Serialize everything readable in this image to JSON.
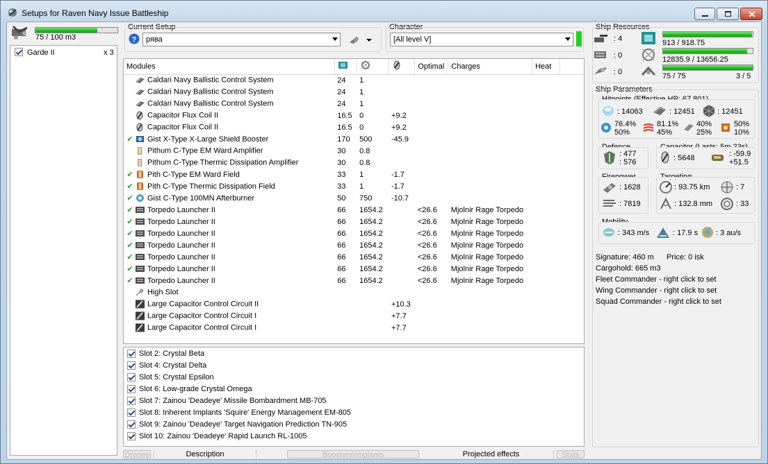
{
  "window": {
    "title": "Setups for Raven Navy Issue Battleship"
  },
  "drones": {
    "capacity_text": "75 / 100 m3",
    "capacity_fraction": 0.75,
    "items": [
      {
        "name": "Garde II",
        "qty": "x 3"
      }
    ]
  },
  "setup": {
    "label": "Current Setup",
    "value": "рява"
  },
  "character": {
    "label": "Character",
    "value": "[All level V]"
  },
  "modules": {
    "headers": [
      "Modules",
      "",
      "",
      "",
      "Optimal",
      "Charges",
      "Heat"
    ],
    "rows": [
      {
        "active": false,
        "icon": "ballistic",
        "name": "Caldari Navy Ballistic Control System",
        "cpu": "24",
        "pg": "1",
        "cap": "",
        "optimal": "",
        "charges": ""
      },
      {
        "active": false,
        "icon": "ballistic",
        "name": "Caldari Navy Ballistic Control System",
        "cpu": "24",
        "pg": "1",
        "cap": "",
        "optimal": "",
        "charges": ""
      },
      {
        "active": false,
        "icon": "ballistic",
        "name": "Caldari Navy Ballistic Control System",
        "cpu": "24",
        "pg": "1",
        "cap": "",
        "optimal": "",
        "charges": ""
      },
      {
        "active": false,
        "icon": "capflux",
        "name": "Capacitor Flux Coil II",
        "cpu": "16.5",
        "pg": "0",
        "cap": "+9.2",
        "optimal": "",
        "charges": ""
      },
      {
        "active": false,
        "icon": "capflux",
        "name": "Capacitor Flux Coil II",
        "cpu": "16.5",
        "pg": "0",
        "cap": "+9.2",
        "optimal": "",
        "charges": ""
      },
      {
        "active": true,
        "icon": "booster",
        "name": "Gist X-Type X-Large Shield Booster",
        "cpu": "170",
        "pg": "500",
        "cap": "-45.9",
        "optimal": "",
        "charges": ""
      },
      {
        "active": false,
        "icon": "amplifier",
        "name": "Pithum C-Type EM Ward Amplifier",
        "cpu": "30",
        "pg": "0.8",
        "cap": "",
        "optimal": "",
        "charges": ""
      },
      {
        "active": false,
        "icon": "amplifier",
        "name": "Pithum C-Type Thermic Dissipation Amplifier",
        "cpu": "30",
        "pg": "0.8",
        "cap": "",
        "optimal": "",
        "charges": ""
      },
      {
        "active": true,
        "icon": "field",
        "name": "Pith C-Type EM Ward Field",
        "cpu": "33",
        "pg": "1",
        "cap": "-1.7",
        "optimal": "",
        "charges": ""
      },
      {
        "active": true,
        "icon": "field",
        "name": "Pith C-Type Thermic Dissipation Field",
        "cpu": "33",
        "pg": "1",
        "cap": "-1.7",
        "optimal": "",
        "charges": ""
      },
      {
        "active": true,
        "icon": "afterburner",
        "name": "Gist C-Type 100MN Afterburner",
        "cpu": "50",
        "pg": "750",
        "cap": "-10.7",
        "optimal": "",
        "charges": ""
      },
      {
        "active": true,
        "icon": "launcher",
        "name": "Torpedo Launcher II",
        "cpu": "66",
        "pg": "1654.2",
        "cap": "",
        "optimal": "<26.6",
        "charges": "Mjolnir Rage Torpedo"
      },
      {
        "active": true,
        "icon": "launcher",
        "name": "Torpedo Launcher II",
        "cpu": "66",
        "pg": "1654.2",
        "cap": "",
        "optimal": "<26.6",
        "charges": "Mjolnir Rage Torpedo"
      },
      {
        "active": true,
        "icon": "launcher",
        "name": "Torpedo Launcher II",
        "cpu": "66",
        "pg": "1654.2",
        "cap": "",
        "optimal": "<26.6",
        "charges": "Mjolnir Rage Torpedo"
      },
      {
        "active": true,
        "icon": "launcher",
        "name": "Torpedo Launcher II",
        "cpu": "66",
        "pg": "1654.2",
        "cap": "",
        "optimal": "<26.6",
        "charges": "Mjolnir Rage Torpedo"
      },
      {
        "active": true,
        "icon": "launcher",
        "name": "Torpedo Launcher II",
        "cpu": "66",
        "pg": "1654.2",
        "cap": "",
        "optimal": "<26.6",
        "charges": "Mjolnir Rage Torpedo"
      },
      {
        "active": true,
        "icon": "launcher",
        "name": "Torpedo Launcher II",
        "cpu": "66",
        "pg": "1654.2",
        "cap": "",
        "optimal": "<26.6",
        "charges": "Mjolnir Rage Torpedo"
      },
      {
        "active": true,
        "icon": "launcher",
        "name": "Torpedo Launcher II",
        "cpu": "66",
        "pg": "1654.2",
        "cap": "",
        "optimal": "<26.6",
        "charges": "Mjolnir Rage Torpedo"
      },
      {
        "active": false,
        "icon": "highslot",
        "name": "High Slot",
        "cpu": "",
        "pg": "",
        "cap": "",
        "optimal": "",
        "charges": ""
      },
      {
        "active": false,
        "icon": "capcircuit",
        "name": "Large Capacitor Control Circuit II",
        "cpu": "",
        "pg": "",
        "cap": "+10.3",
        "optimal": "",
        "charges": ""
      },
      {
        "active": false,
        "icon": "capcircuit",
        "name": "Large Capacitor Control Circuit I",
        "cpu": "",
        "pg": "",
        "cap": "+7.7",
        "optimal": "",
        "charges": ""
      },
      {
        "active": false,
        "icon": "capcircuit",
        "name": "Large Capacitor Control Circuit I",
        "cpu": "",
        "pg": "",
        "cap": "+7.7",
        "optimal": "",
        "charges": ""
      }
    ]
  },
  "implants": [
    "Slot 2: Crystal Beta",
    "Slot 4: Crystal Delta",
    "Slot 5: Crystal Epsilon",
    "Slot 6: Low-grade Crystal Omega",
    "Slot 7: Zainou 'Deadeye' Missile Bombardment MB-705",
    "Slot 8: Inherent Implants 'Squire' Energy Management EM-805",
    "Slot 9: Zainou 'Deadeye' Target Navigation Prediction TN-905",
    "Slot 10: Zainou 'Deadeye' Rapid Launch RL-1005"
  ],
  "tabs": {
    "drones": "Drones",
    "description": "Description",
    "boosters": "Boosters\\Implants",
    "projected": "Projected effects",
    "stats": "Stats"
  },
  "resources": {
    "label": "Ship Resources",
    "turrets": ": 4",
    "launchers_free": ": 0",
    "calibration": ": 0",
    "cpu_text": "913 / 918.75",
    "cpu_fraction": 0.994,
    "pg_text": "12835.9 / 13656.25",
    "pg_fraction": 0.94,
    "drone_bw_text": "75 / 75",
    "drone_bw_fraction": 1.0,
    "drones_active": "3 / 5"
  },
  "params": {
    "label": "Ship Parameters",
    "hitpoints_label": "Hitpoints (Effective HP: 67,801)",
    "shield_hp": ": 14063",
    "armor_hp": ": 12451",
    "hull_hp": ": 12451",
    "resists": [
      {
        "top": "76.4%",
        "bottom": "50%"
      },
      {
        "top": "81.1%",
        "bottom": "45%"
      },
      {
        "top": "40%",
        "bottom": "25%"
      },
      {
        "top": "50%",
        "bottom": "10%"
      }
    ],
    "defence_label": "Defence",
    "defence_top": ": 477",
    "defence_bottom": ": 576",
    "capacitor_label": "Capacitor (Lasts: 5m 23s)",
    "capacitor_amount": ": 5648",
    "capacitor_top": ": -59.9",
    "capacitor_bottom": "+51.5",
    "firepower_label": "Firepower",
    "dps": ": 1628",
    "volley": ": 7819",
    "targeting_label": "Targeting",
    "target_range": ": 93.75 km",
    "max_targets": ": 7",
    "scan_res": ": 132.8 mm",
    "sensor_strength": ": 33",
    "mobility_label": "Mobility",
    "speed": ": 343 m/s",
    "align": ": 17.9 s",
    "warp": ": 3 au/s"
  },
  "info": {
    "signature": "Signature: 460 m",
    "price": "Price: 0 isk",
    "cargohold": "Cargohold: 665 m3",
    "fleet": "Fleet Commander - right click to set",
    "wing": "Wing Commander - right click to set",
    "squad": "Squad Commander - right click to set"
  },
  "colors": {
    "bar_green": "#1fbb1f",
    "accent_blue": "#2b4d86",
    "check_green": "#2e9e2e"
  }
}
